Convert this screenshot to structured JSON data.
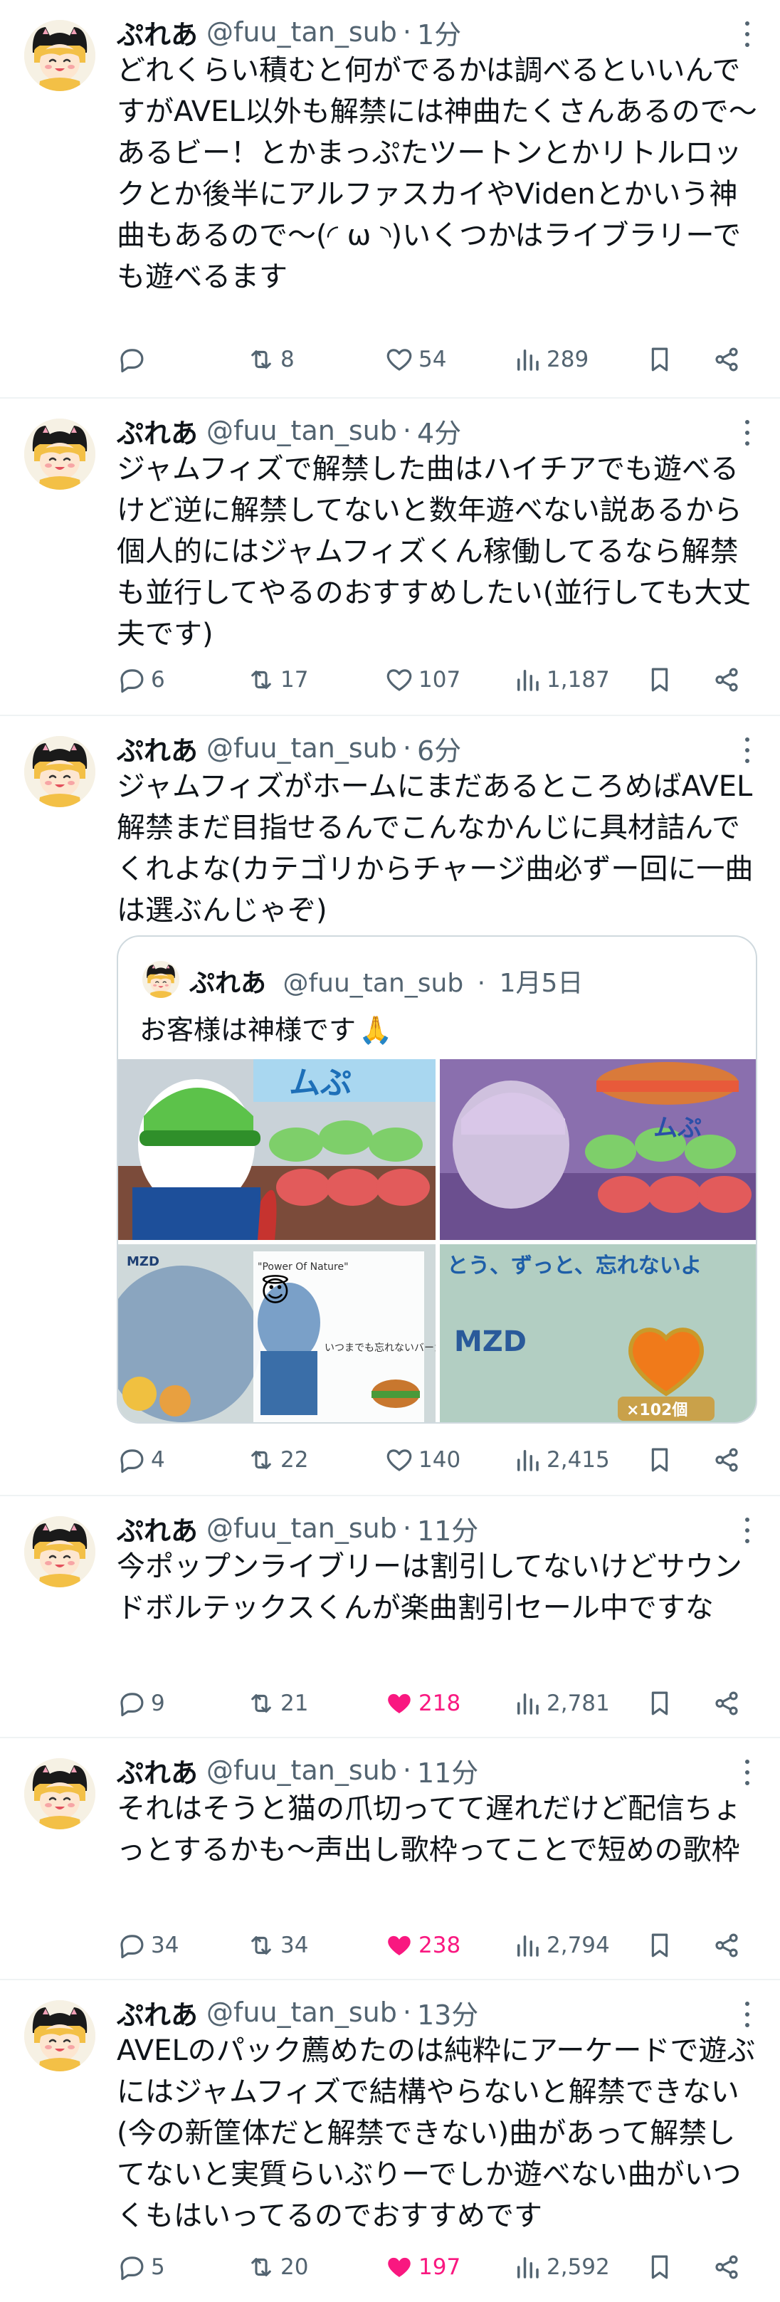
{
  "tweets": [
    {
      "name": "ぷれあ",
      "handle": "@fuu_tan_sub",
      "time": "1分",
      "text": "どれくらい積むと何がでるかは調べるといいんですがAVEL以外も解禁には神曲たくさんあるので〜\nあるビー！とかまっぷたツートンとかリトルロックとか後半にアルファスカイやVidenとかいう神曲もあるので〜(◜ ω ◝)いくつかはライブラリーでも遊べるます",
      "replies": "",
      "retweets": "8",
      "likes": "54",
      "views": "289",
      "liked": false
    },
    {
      "name": "ぷれあ",
      "handle": "@fuu_tan_sub",
      "time": "4分",
      "text": "ジャムフィズで解禁した曲はハイチアでも遊べるけど逆に解禁してないと数年遊べない説あるから個人的にはジャムフィズくん稼働してるなら解禁も並行してやるのおすすめしたい(並行しても大丈夫です)",
      "replies": "6",
      "retweets": "17",
      "likes": "107",
      "views": "1,187",
      "liked": false
    },
    {
      "name": "ぷれあ",
      "handle": "@fuu_tan_sub",
      "time": "6分",
      "text": "ジャムフィズがホームにまだあるところめばAVEL解禁まだ目指せるんでこんなかんじに具材詰んでくれよな(カテゴリからチャージ曲必ずー回に一曲は選ぶんじゃぞ)",
      "replies": "4",
      "retweets": "22",
      "likes": "140",
      "views": "2,415",
      "liked": false,
      "quote": {
        "name": "ぷれあ",
        "handle": "@fuu_tan_sub",
        "time": "1月5日",
        "text": "お客様は神様です",
        "emoji": "🙏",
        "images": [
          {
            "name": "pop-character-green-cap"
          },
          {
            "name": "pop-character-purple"
          },
          {
            "name": "album-artwork-card",
            "labels": [
              "MZD",
              "いつまでも忘れないバーガー",
              "\"Power Of Nature\""
            ]
          },
          {
            "name": "burger-heart-card",
            "labels": [
              "とう、ずっと、忘れないよ",
              "MZD",
              "×102個"
            ]
          }
        ]
      }
    },
    {
      "name": "ぷれあ",
      "handle": "@fuu_tan_sub",
      "time": "11分",
      "text": "今ポップンライブリーは割引してないけどサウンドボルテックスくんが楽曲割引セール中ですな",
      "replies": "9",
      "retweets": "21",
      "likes": "218",
      "views": "2,781",
      "liked": true
    },
    {
      "name": "ぷれあ",
      "handle": "@fuu_tan_sub",
      "time": "11分",
      "text": "それはそうと猫の爪切ってて遅れだけど配信ちょっとするかも〜声出し歌枠ってことで短めの歌枠",
      "replies": "34",
      "retweets": "34",
      "likes": "238",
      "views": "2,794",
      "liked": true
    },
    {
      "name": "ぷれあ",
      "handle": "@fuu_tan_sub",
      "time": "13分",
      "text": "AVELのパック薦めたのは純粋にアーケードで遊ぶにはジャムフィズで結構やらないと解禁できない(今の新筐体だと解禁できない)曲があって解禁してないと実質らいぶりーでしか遊べない曲がいつくもはいってるのでおすすめです",
      "replies": "5",
      "retweets": "20",
      "likes": "197",
      "views": "2,592",
      "liked": true
    }
  ],
  "colors": {
    "text": "#0f1419",
    "secondary": "#536471",
    "like": "#f91880",
    "border": "#eff3f4"
  },
  "icons": [
    "reply-icon",
    "retweet-icon",
    "heart-icon",
    "views-icon",
    "bookmark-icon",
    "share-icon",
    "more-icon"
  ]
}
